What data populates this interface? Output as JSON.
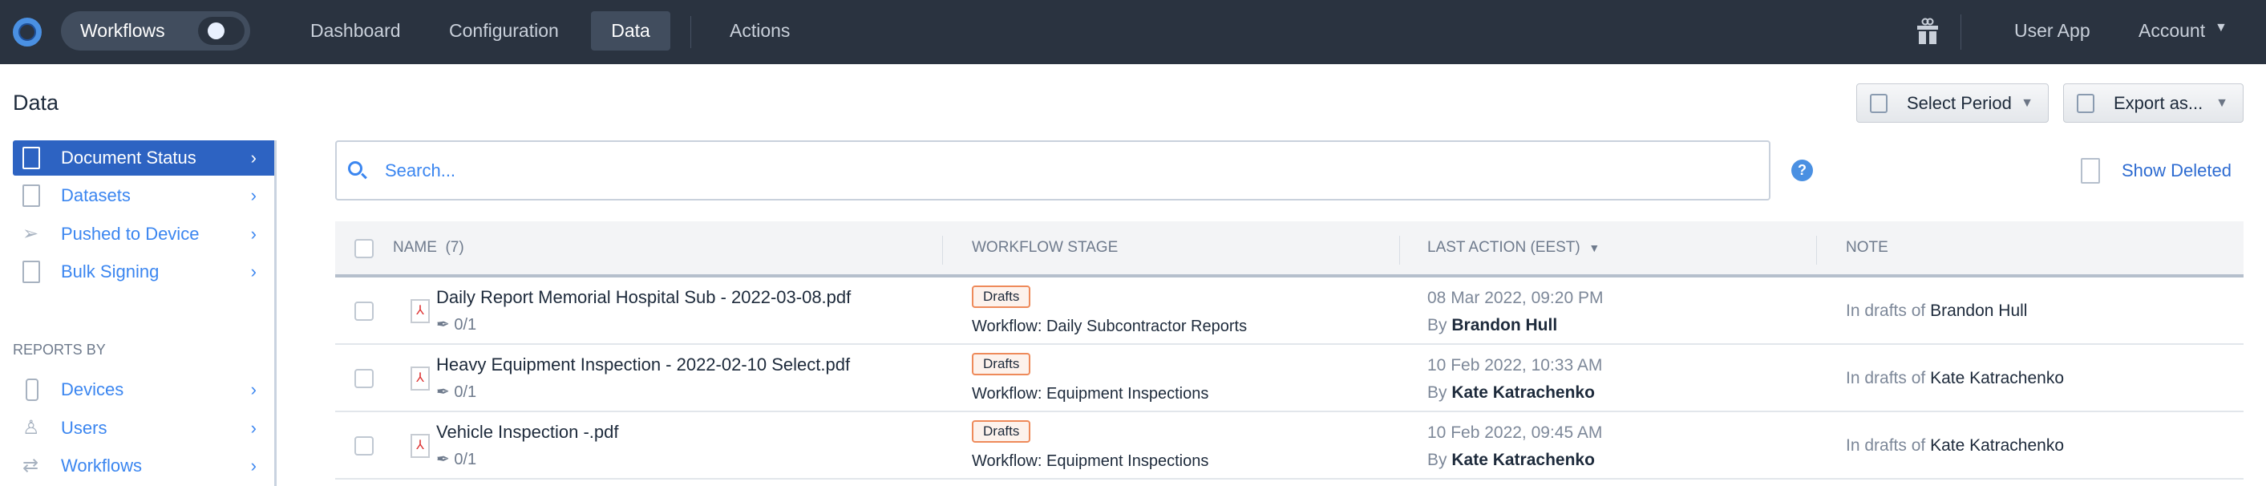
{
  "nav": {
    "workflows_toggle": "Workflows",
    "links": [
      "Dashboard",
      "Configuration",
      "Data",
      "Actions"
    ],
    "active": "Data",
    "user_app": "User App",
    "account": "Account"
  },
  "page": {
    "title": "Data",
    "select_period": "Select Period",
    "export_as": "Export as...",
    "show_deleted": "Show Deleted",
    "search_placeholder": "Search...",
    "help": "?"
  },
  "sidebar": {
    "items": [
      {
        "label": "Document Status",
        "icon": "document-status-icon",
        "active": true
      },
      {
        "label": "Datasets",
        "icon": "datasets-icon"
      },
      {
        "label": "Pushed to Device",
        "icon": "send-icon"
      },
      {
        "label": "Bulk Signing",
        "icon": "bulk-signing-icon"
      }
    ],
    "section_title": "REPORTS BY",
    "reports": [
      {
        "label": "Devices",
        "icon": "device-icon"
      },
      {
        "label": "Users",
        "icon": "user-icon"
      },
      {
        "label": "Workflows",
        "icon": "workflows-icon"
      }
    ]
  },
  "table": {
    "columns": {
      "name": "NAME",
      "count": "(7)",
      "stage": "WORKFLOW STAGE",
      "last_action": "LAST ACTION (EEST)",
      "note": "NOTE"
    },
    "rows": [
      {
        "name": "Daily Report Memorial Hospital Sub - 2022-03-08.pdf",
        "signatures": "0/1",
        "badge": "Drafts",
        "workflow": "Workflow: Daily Subcontractor Reports",
        "date": "08 Mar 2022, 09:20 PM",
        "by_prefix": "By",
        "by": "Brandon Hull",
        "note_prefix": "In drafts of",
        "note_name": "Brandon Hull"
      },
      {
        "name": "Heavy Equipment Inspection - 2022-02-10 Select.pdf",
        "signatures": "0/1",
        "badge": "Drafts",
        "workflow": "Workflow: Equipment Inspections",
        "date": "10 Feb 2022, 10:33 AM",
        "by_prefix": "By",
        "by": "Kate Katrachenko",
        "note_prefix": "In drafts of",
        "note_name": "Kate Katrachenko"
      },
      {
        "name": "Vehicle Inspection -.pdf",
        "signatures": "0/1",
        "badge": "Drafts",
        "workflow": "Workflow: Equipment Inspections",
        "date": "10 Feb 2022, 09:45 AM",
        "by_prefix": "By",
        "by": "Kate Katrachenko",
        "note_prefix": "In drafts of",
        "note_name": "Kate Katrachenko"
      }
    ]
  }
}
